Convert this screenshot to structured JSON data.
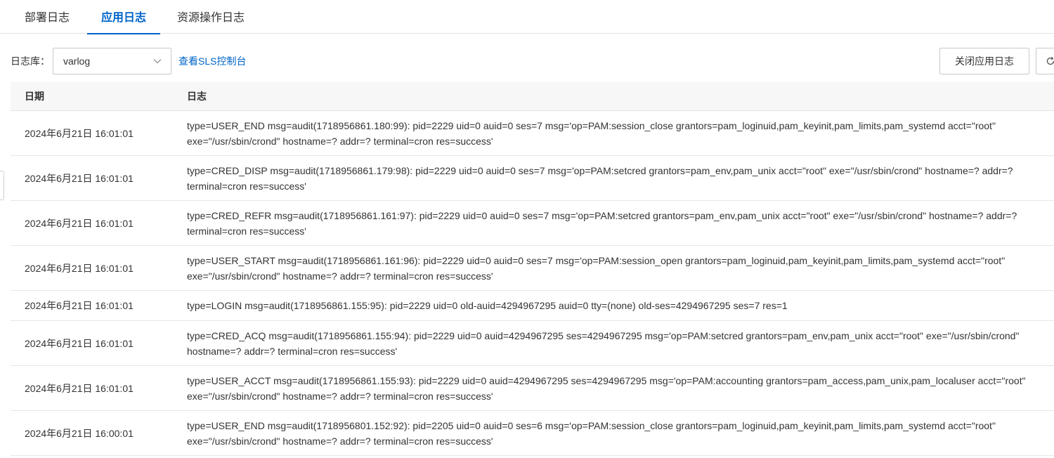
{
  "tabs": [
    {
      "label": "部署日志",
      "active": false
    },
    {
      "label": "应用日志",
      "active": true
    },
    {
      "label": "资源操作日志",
      "active": false
    }
  ],
  "toolbar": {
    "logstore_label": "日志库：",
    "logstore_value": "varlog",
    "sls_link": "查看SLS控制台",
    "close_button": "关闭应用日志",
    "refresh_icon": "refresh-icon"
  },
  "table": {
    "headers": {
      "date": "日期",
      "log": "日志"
    },
    "rows": [
      {
        "date": "2024年6月21日 16:01:01",
        "log": "type=USER_END msg=audit(1718956861.180:99): pid=2229 uid=0 auid=0 ses=7 msg='op=PAM:session_close grantors=pam_loginuid,pam_keyinit,pam_limits,pam_systemd acct=\"root\" exe=\"/usr/sbin/crond\" hostname=? addr=? terminal=cron res=success'"
      },
      {
        "date": "2024年6月21日 16:01:01",
        "log": "type=CRED_DISP msg=audit(1718956861.179:98): pid=2229 uid=0 auid=0 ses=7 msg='op=PAM:setcred grantors=pam_env,pam_unix acct=\"root\" exe=\"/usr/sbin/crond\" hostname=? addr=? terminal=cron res=success'"
      },
      {
        "date": "2024年6月21日 16:01:01",
        "log": "type=CRED_REFR msg=audit(1718956861.161:97): pid=2229 uid=0 auid=0 ses=7 msg='op=PAM:setcred grantors=pam_env,pam_unix acct=\"root\" exe=\"/usr/sbin/crond\" hostname=? addr=? terminal=cron res=success'"
      },
      {
        "date": "2024年6月21日 16:01:01",
        "log": "type=USER_START msg=audit(1718956861.161:96): pid=2229 uid=0 auid=0 ses=7 msg='op=PAM:session_open grantors=pam_loginuid,pam_keyinit,pam_limits,pam_systemd acct=\"root\" exe=\"/usr/sbin/crond\" hostname=? addr=? terminal=cron res=success'"
      },
      {
        "date": "2024年6月21日 16:01:01",
        "log": "type=LOGIN msg=audit(1718956861.155:95): pid=2229 uid=0 old-auid=4294967295 auid=0 tty=(none) old-ses=4294967295 ses=7 res=1"
      },
      {
        "date": "2024年6月21日 16:01:01",
        "log": "type=CRED_ACQ msg=audit(1718956861.155:94): pid=2229 uid=0 auid=4294967295 ses=4294967295 msg='op=PAM:setcred grantors=pam_env,pam_unix acct=\"root\" exe=\"/usr/sbin/crond\" hostname=? addr=? terminal=cron res=success'"
      },
      {
        "date": "2024年6月21日 16:01:01",
        "log": "type=USER_ACCT msg=audit(1718956861.155:93): pid=2229 uid=0 auid=4294967295 ses=4294967295 msg='op=PAM:accounting grantors=pam_access,pam_unix,pam_localuser acct=\"root\" exe=\"/usr/sbin/crond\" hostname=? addr=? terminal=cron res=success'"
      },
      {
        "date": "2024年6月21日 16:00:01",
        "log": "type=USER_END msg=audit(1718956801.152:92): pid=2205 uid=0 auid=0 ses=6 msg='op=PAM:session_close grantors=pam_loginuid,pam_keyinit,pam_limits,pam_systemd acct=\"root\" exe=\"/usr/sbin/crond\" hostname=? addr=? terminal=cron res=success'"
      }
    ]
  },
  "colors": {
    "accent": "#0064c8",
    "header_bg": "#f7f7f7",
    "border": "#e3e3e3"
  }
}
